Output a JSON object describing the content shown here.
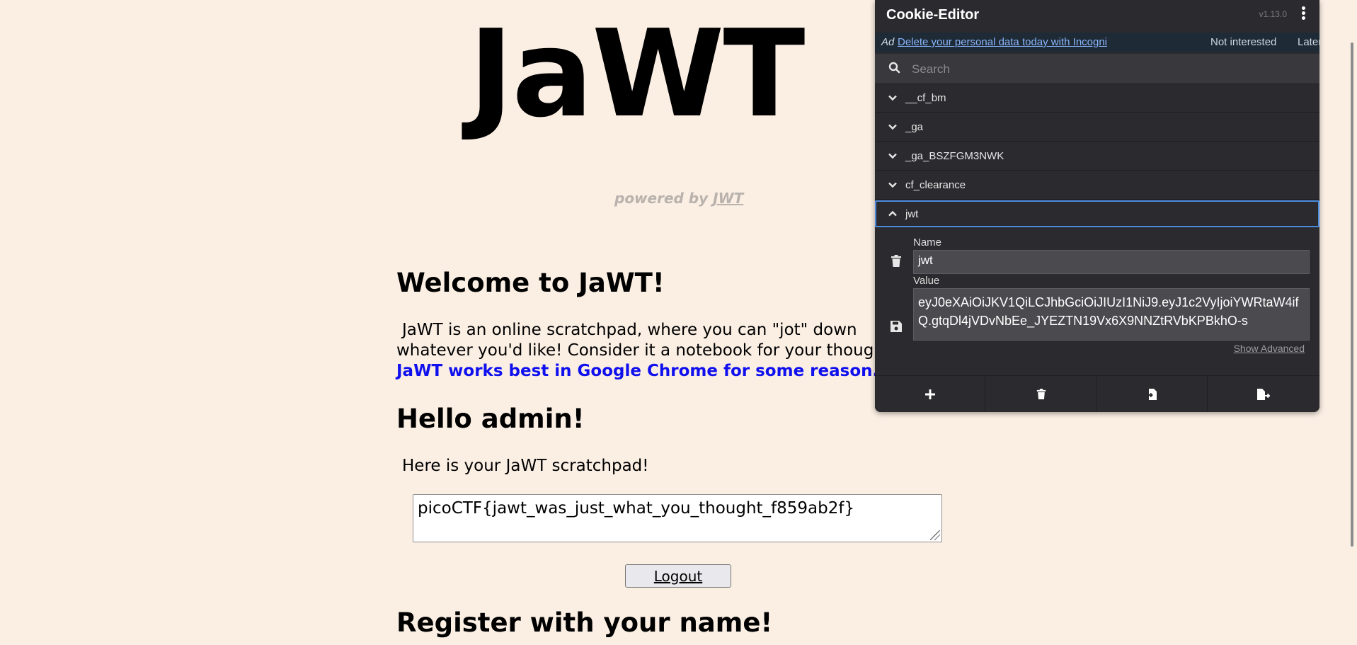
{
  "page": {
    "logo": "JaWT",
    "powered_by_prefix": "powered by ",
    "powered_by_link": "JWT",
    "welcome_heading": "Welcome to JaWT!",
    "intro_line1": "JaWT is an online scratchpad, where you can \"jot\" down",
    "intro_line2": "whatever you'd like! Consider it a notebook for your thoughts.",
    "intro_blue": "JaWT works best in Google Chrome for some reason.",
    "hello_heading": "Hello admin!",
    "scratchpad_label": "Here is your JaWT scratchpad!",
    "scratchpad_value": "picoCTF{jawt_was_just_what_you_thought_f859ab2f}",
    "logout_label": "Logout",
    "register_heading": "Register with your name!"
  },
  "cookie_editor": {
    "title": "Cookie-Editor",
    "version": "v1.13.0",
    "ad": {
      "tag": "Ad",
      "link_text": "Delete your personal data today with Incogni",
      "not_interested": "Not interested",
      "later": "Later"
    },
    "search_placeholder": "Search",
    "cookies": [
      {
        "name": "__cf_bm",
        "expanded": false
      },
      {
        "name": "_ga",
        "expanded": false
      },
      {
        "name": "_ga_BSZFGM3NWK",
        "expanded": false
      },
      {
        "name": "cf_clearance",
        "expanded": false
      },
      {
        "name": "jwt",
        "expanded": true
      }
    ],
    "detail": {
      "name_label": "Name",
      "name_value": "jwt",
      "value_label": "Value",
      "value_value": "eyJ0eXAiOiJKV1QiLCJhbGciOiJIUzI1NiJ9.eyJ1c2VyIjoiYWRtaW4ifQ.gtqDl4jVDvNbEe_JYEZTN19Vx6X9NNZtRVbKPBkhO-s",
      "show_advanced": "Show Advanced"
    },
    "actions": [
      "add-icon",
      "delete-all-icon",
      "import-icon",
      "export-icon"
    ]
  }
}
